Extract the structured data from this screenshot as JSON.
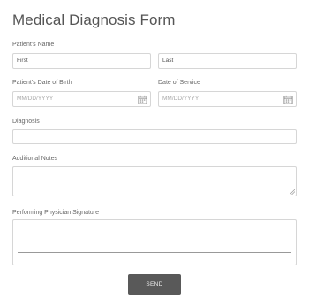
{
  "form": {
    "title": "Medical Diagnosis Form",
    "patient_name": {
      "label": "Patient's Name",
      "first_placeholder": "First",
      "last_placeholder": "Last"
    },
    "dob": {
      "label": "Patient's Date of Birth",
      "placeholder": "MM/DD/YYYY",
      "icon": "calendar-icon"
    },
    "date_of_service": {
      "label": "Date of Service",
      "placeholder": "MM/DD/YYYY",
      "icon": "calendar-icon"
    },
    "diagnosis": {
      "label": "Diagnosis",
      "value": ""
    },
    "notes": {
      "label": "Additional Notes",
      "value": ""
    },
    "signature": {
      "label": "Performing Physician Signature"
    },
    "send_label": "SEND"
  },
  "colors": {
    "button_bg": "#595959",
    "border": "#d6d6d6"
  }
}
